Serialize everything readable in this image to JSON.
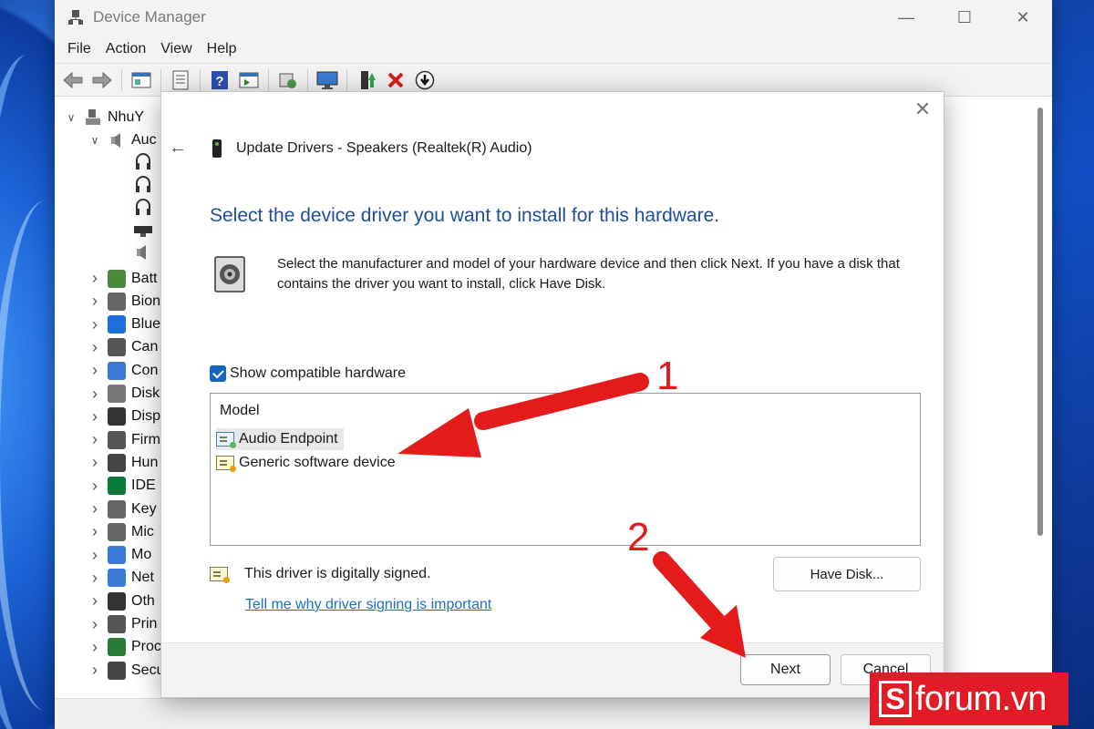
{
  "device_manager": {
    "title": "Device Manager",
    "menu": [
      "File",
      "Action",
      "View",
      "Help"
    ],
    "toolbar_icons": [
      "back-arrow-icon",
      "forward-arrow-icon",
      "properties-icon",
      "show-hide-icon",
      "help-icon",
      "view-icon",
      "scan-hardware-icon",
      "monitor-icon",
      "update-driver-icon",
      "uninstall-icon",
      "disable-icon"
    ],
    "tree_root": "NhuY",
    "tree_expanded": "Auc",
    "tree_items": [
      "Auc",
      "Batt",
      "Bion",
      "Blue",
      "Can",
      "Con",
      "Disk",
      "Disp",
      "Firm",
      "Hun",
      "IDE",
      "Key",
      "Mic",
      "Mo",
      "Net",
      "Oth",
      "Prin",
      "Proc",
      "Secu"
    ]
  },
  "dialog": {
    "title": "Update Drivers - Speakers (Realtek(R) Audio)",
    "heading": "Select the device driver you want to install for this hardware.",
    "description": "Select the manufacturer and model of your hardware device and then click Next. If you have a disk that contains the driver you want to install, click Have Disk.",
    "show_compatible_label": "Show compatible hardware",
    "show_compatible_checked": true,
    "model_header": "Model",
    "models": [
      "Audio Endpoint",
      "Generic software device"
    ],
    "signed_text": "This driver is digitally signed.",
    "signing_link": "Tell me why driver signing is important",
    "have_disk_label": "Have Disk...",
    "next_label": "Next",
    "cancel_label": "Cancel"
  },
  "annotations": {
    "step1": "1",
    "step2": "2",
    "color": "#e41b1b"
  },
  "watermark": {
    "logo_letter": "S",
    "text": "forum.vn",
    "color": "#e21c26"
  }
}
